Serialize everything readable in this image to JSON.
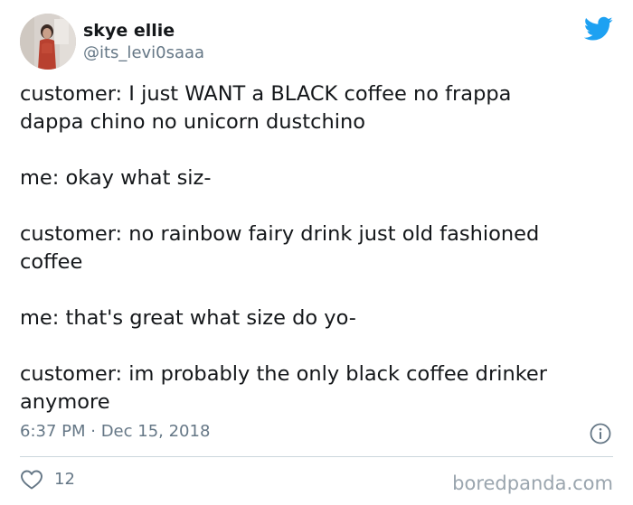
{
  "author": {
    "display_name": "skye ellie",
    "handle": "@its_levi0saaa"
  },
  "tweet": {
    "paragraphs": [
      [
        "customer: I just WANT a BLACK coffee no frappa",
        "dappa chino no unicorn dustchino"
      ],
      [
        "me: okay what siz-"
      ],
      [
        "customer: no rainbow fairy drink just old fashioned",
        "coffee"
      ],
      [
        "me: that's great what size do yo-"
      ],
      [
        "customer: im probably the only black coffee drinker",
        "anymore"
      ]
    ],
    "timestamp": "6:37 PM · Dec 15, 2018"
  },
  "engagement": {
    "likes": "12"
  },
  "watermark": "boredpanda.com",
  "colors": {
    "twitter_blue": "#1da1f2",
    "text": "#14171a",
    "secondary_text": "#657786",
    "divider": "#ccd6dd"
  },
  "icons": {
    "logo": "twitter-bird-icon",
    "info": "info-icon",
    "like": "heart-icon"
  }
}
